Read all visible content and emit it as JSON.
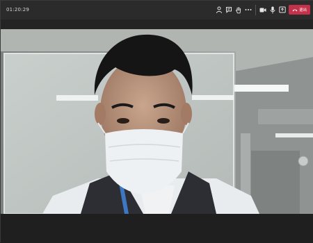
{
  "call": {
    "duration": "01:20:29"
  },
  "toolbar": {
    "people_icon": "people-icon",
    "chat_icon": "chat-icon",
    "raise_hand_icon": "raise-hand-icon",
    "more_icon": "more-icon",
    "camera_icon": "camera-icon",
    "mic_icon": "mic-icon",
    "share_icon": "share-screen-icon",
    "leave_label": "退出"
  },
  "colors": {
    "leave": "#c4314b",
    "topbar": "#2b2b2b",
    "background": "#1f1f1f"
  }
}
